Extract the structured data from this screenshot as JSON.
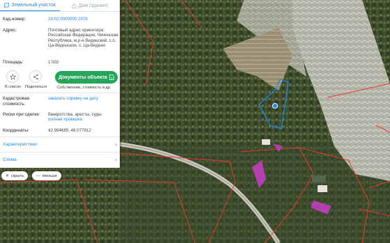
{
  "tabs": [
    {
      "label": "Земельный участок"
    },
    {
      "label": "Дом (здание)"
    }
  ],
  "fields": {
    "cadnum": {
      "label": "Кад.номер:",
      "value": "20:02:0000000:2078"
    },
    "address": {
      "label": "Адрес:",
      "value": "Почтовый адрес ориентира: Российская Федерация, Чеченская Республика, м.р-н Веденский, с.п. Ца-Веденское, с. Ца-Ведено"
    },
    "area": {
      "label": "Площадь:",
      "value": "1 502"
    },
    "cadvalue": {
      "label": "Кадастровая стоимость:",
      "value": "заказать справку на дату"
    },
    "risks": {
      "label": "Риски при сделке:",
      "value": "банкротства, аресты, суды",
      "link": "полная проверка"
    },
    "coords": {
      "label": "Координаты:",
      "value": "42.994685, 46.077912"
    }
  },
  "actions": {
    "favorite_label": "В список",
    "share_label": "Поделиться",
    "documents_label": "Документы объекта",
    "documents_sub": "Собственник, стоимость и др."
  },
  "sections": {
    "characteristics": "Характеристики",
    "scheme": "Схема"
  },
  "map_controls": {
    "hide": "скрыть",
    "less": "меньше"
  },
  "colors": {
    "accent": "#1e88e5",
    "button_green": "#26a65b",
    "parcel_red": "#e53935",
    "building_magenta": "#c83cc8"
  }
}
